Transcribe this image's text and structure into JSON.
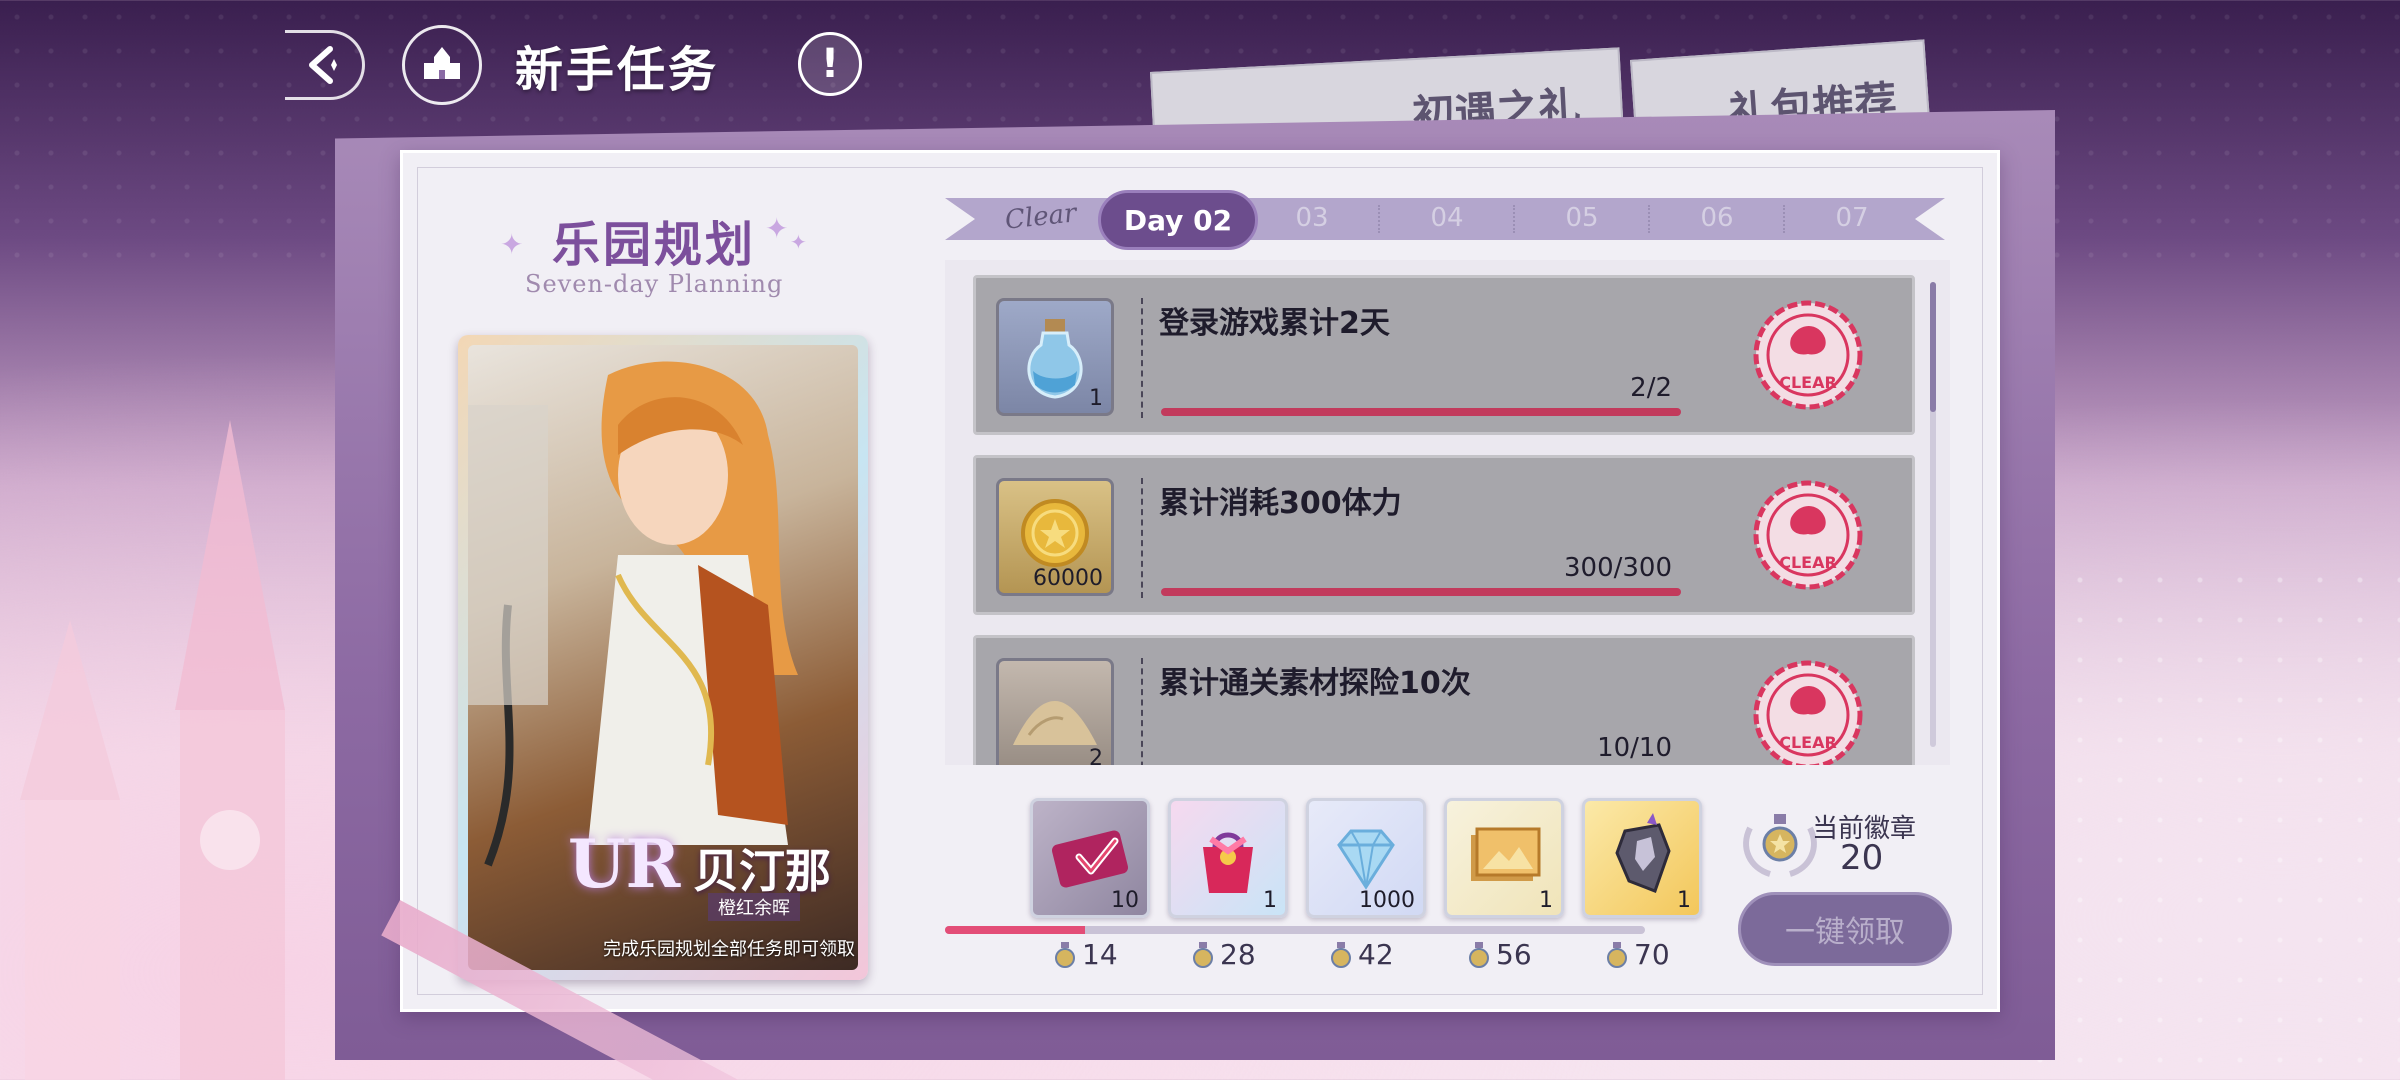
{
  "header": {
    "title": "新手任务",
    "info_symbol": "!"
  },
  "tabs": [
    {
      "label": "初遇之礼"
    },
    {
      "label": "礼包推荐"
    }
  ],
  "plan": {
    "title": "乐园规划",
    "subtitle": "Seven-day Planning"
  },
  "character": {
    "rarity": "UR",
    "name": "贝汀那",
    "subname": "橙红余晖",
    "note": "完成乐园规划全部任务即可领取"
  },
  "days": {
    "clear_label": "Clear",
    "active": "Day 02",
    "others": [
      "03",
      "04",
      "05",
      "06",
      "07"
    ]
  },
  "tasks": [
    {
      "title": "登录游戏累计2天",
      "progress_text": "2/2",
      "progress": 1.0,
      "reward_count": "1",
      "icon": "potion-bottle-icon",
      "stamp": "CLEAR"
    },
    {
      "title": "累计消耗300体力",
      "progress_text": "300/300",
      "progress": 1.0,
      "reward_count": "60000",
      "icon": "gold-coin-icon",
      "stamp": "CLEAR"
    },
    {
      "title": "累计通关素材探险10次",
      "progress_text": "10/10",
      "progress": 1.0,
      "reward_count": "2",
      "icon": "sand-pile-icon",
      "stamp": "CLEAR"
    }
  ],
  "rewards": [
    {
      "count": "10",
      "milestone": "14",
      "icon": "ticket-icon"
    },
    {
      "count": "1",
      "milestone": "28",
      "icon": "gift-bag-icon"
    },
    {
      "count": "1000",
      "milestone": "42",
      "icon": "diamond-icon"
    },
    {
      "count": "1",
      "milestone": "56",
      "icon": "picture-frame-icon"
    },
    {
      "count": "1",
      "milestone": "70",
      "icon": "armor-shard-icon"
    }
  ],
  "badge": {
    "label": "当前徽章",
    "value": "20",
    "progress": 0.2
  },
  "claim_all_label": "一键领取",
  "colors": {
    "accent_purple": "#6c4d8d",
    "progress_red": "#c23a5c",
    "stamp_red": "#d9365f"
  }
}
